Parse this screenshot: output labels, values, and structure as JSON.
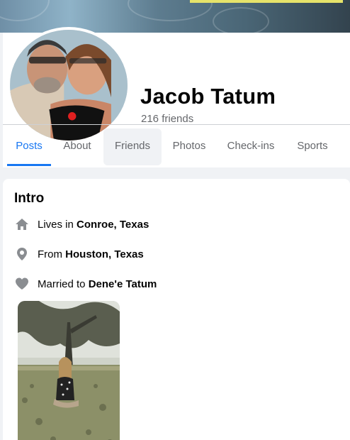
{
  "profile": {
    "name": "Jacob Tatum",
    "friends_count": "216 friends"
  },
  "tabs": [
    {
      "label": "Posts",
      "active": true
    },
    {
      "label": "About",
      "active": false
    },
    {
      "label": "Friends",
      "active": false
    },
    {
      "label": "Photos",
      "active": false
    },
    {
      "label": "Check-ins",
      "active": false
    },
    {
      "label": "Sports",
      "active": false
    }
  ],
  "intro": {
    "title": "Intro",
    "items": [
      {
        "icon": "home-icon",
        "prefix": "Lives in ",
        "value": "Conroe, Texas"
      },
      {
        "icon": "location-pin-icon",
        "prefix": "From ",
        "value": "Houston, Texas"
      },
      {
        "icon": "heart-icon",
        "prefix": "Married to ",
        "value": "Dene'e Tatum"
      }
    ]
  },
  "colors": {
    "accent": "#1877f2",
    "secondary_text": "#65676b",
    "background": "#f0f2f5"
  }
}
